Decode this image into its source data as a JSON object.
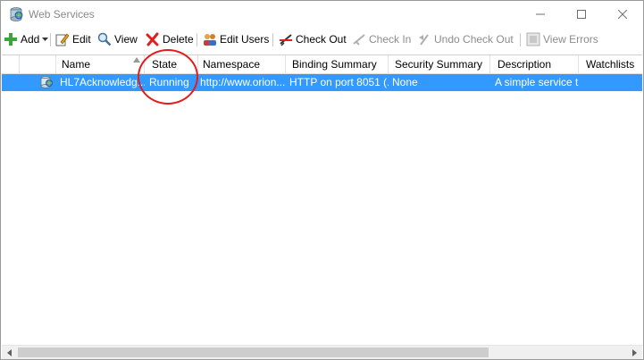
{
  "window": {
    "title": "Web Services",
    "icon": "web-services-icon"
  },
  "toolbar": {
    "add_label": "Add",
    "edit_label": "Edit",
    "view_label": "View",
    "delete_label": "Delete",
    "edit_users_label": "Edit Users",
    "check_out_label": "Check Out",
    "check_in_label": "Check In",
    "undo_check_out_label": "Undo Check Out",
    "view_errors_label": "View Errors"
  },
  "grid": {
    "columns": [
      "Name",
      "State",
      "Namespace",
      "Binding Summary",
      "Security Summary",
      "Description",
      "Watchlists"
    ],
    "rows": [
      {
        "name": "HL7Acknowledg...",
        "state": "Running",
        "namespace": "http://www.orion...",
        "binding_summary": "HTTP on port 8051 (...",
        "security_summary": "None",
        "description": "A simple service t...",
        "watchlists": ""
      }
    ],
    "sorted_column": "Name"
  },
  "colors": {
    "selection": "#3399ff",
    "annotation": "#e31b1b"
  }
}
